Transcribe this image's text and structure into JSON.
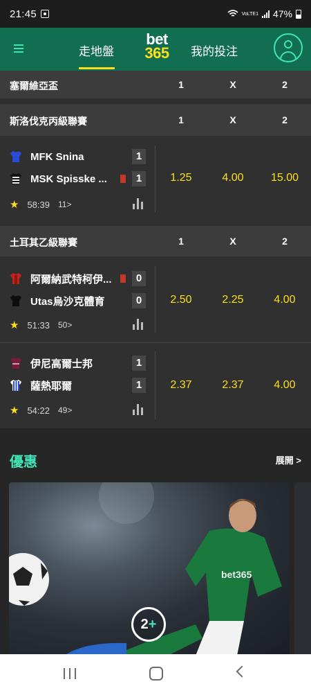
{
  "status_bar": {
    "time": "21:45",
    "volte": "VoLTE1",
    "battery": "47%"
  },
  "header": {
    "tab_live": "走地盤",
    "logo_top": "bet",
    "logo_bottom": "365",
    "tab_my_bets": "我的投注"
  },
  "leagues": [
    {
      "name": "塞爾維亞盃",
      "col1": "1",
      "colx": "X",
      "col2": "2"
    },
    {
      "name": "斯洛伐克丙級聯賽",
      "col1": "1",
      "colx": "X",
      "col2": "2"
    },
    {
      "name": "土耳其乙級聯賽",
      "col1": "1",
      "colx": "X",
      "col2": "2"
    }
  ],
  "matches": [
    {
      "home": "MFK Snina",
      "away": "MSK Spisske ...",
      "home_score": "1",
      "away_score": "1",
      "minute": "58:39",
      "more": "11>",
      "odd1": "1.25",
      "oddx": "4.00",
      "odd2": "15.00"
    },
    {
      "home": "阿爾納武特柯伊...",
      "away": "Utas烏沙克體育",
      "home_score": "0",
      "away_score": "0",
      "minute": "51:33",
      "more": "50>",
      "odd1": "2.50",
      "oddx": "2.25",
      "odd2": "4.00"
    },
    {
      "home": "伊尼高爾士邦",
      "away": "薩熱耶爾",
      "home_score": "1",
      "away_score": "1",
      "minute": "54:22",
      "more": "49>",
      "odd1": "2.37",
      "oddx": "2.37",
      "odd2": "4.00"
    }
  ],
  "offers": {
    "title": "優惠",
    "expand": "展開 >",
    "badge_num": "2",
    "badge_plus": "+",
    "card_text": "bet365"
  },
  "colors": {
    "header_green": "#126e51",
    "accent_yellow": "#ffdf1b",
    "accent_mint": "#40e4b6"
  }
}
